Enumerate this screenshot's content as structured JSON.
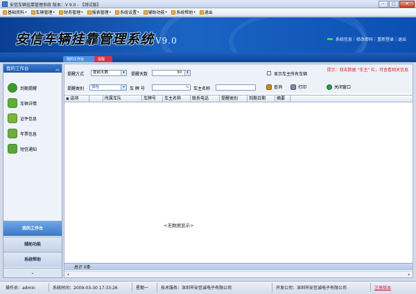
{
  "window": {
    "title": "安信车辆挂靠管理系统 版本：V 9.0 - 【测试版】",
    "buttons": {
      "minimize": "–",
      "maximize": "□",
      "close": "✕"
    }
  },
  "menu": [
    "基础资料",
    "车辆管理",
    "财务管理",
    "报表管理",
    "系统设置",
    "辅助功能",
    "系统帮助",
    "退出"
  ],
  "banner": {
    "title": "安信车辆挂靠管理系统",
    "version": "V9.0",
    "links": [
      "系统信息",
      "修改密码",
      "重新登录",
      "退出"
    ]
  },
  "tabs": [
    "我的工作台",
    "提醒"
  ],
  "sidebar": {
    "header": "我的工作台",
    "items": [
      {
        "label": "到期提醒",
        "icon": "clock-icon",
        "color": "#3a9a2e"
      },
      {
        "label": "车辆详情",
        "icon": "tree-icon",
        "color": "#5fae3a"
      },
      {
        "label": "证件信息",
        "icon": "certificate-icon",
        "color": "#7bb63a"
      },
      {
        "label": "年票信息",
        "icon": "ticket-icon",
        "color": "#6cae3b"
      },
      {
        "label": "短信通知",
        "icon": "message-icon",
        "color": "#58a63a"
      }
    ],
    "bottom": [
      "我的工作台",
      "辅助功能",
      "系统帮助"
    ],
    "scroll": "⌄"
  },
  "filters": {
    "remind_type_label": "提醒方式",
    "remind_type_value": "提前天数",
    "remind_days_label": "提醒天数",
    "remind_days_value": "30",
    "show_all_label": "显示车主所有车辆",
    "remind_category_label": "提醒类别",
    "remind_category_value": "保险",
    "plate_label": "车 牌 号",
    "owner_label": "车主名称",
    "query_button": "查询",
    "print_button": "打印",
    "close_button": "关闭窗口",
    "tip": "提示：双击数据 \"车主\" 栏，可查看相关信息"
  },
  "table": {
    "columns": [
      "选项",
      "所属车队",
      "车牌号",
      "车主名称",
      "联系电话",
      "提醒类别",
      "到期日期",
      "摘要"
    ],
    "empty_text": "<无数据显示>",
    "total": "总计 0条"
  },
  "status": {
    "operator": "操作员：admin",
    "system_time": "系统时间：2009-03-30  17:33:26",
    "weekday": "星期一",
    "developer": "技术服务：深圳市安信诚电子有限公司",
    "company": "开发公司：深圳市安信诚电子有限公司",
    "register": "注册版本"
  }
}
